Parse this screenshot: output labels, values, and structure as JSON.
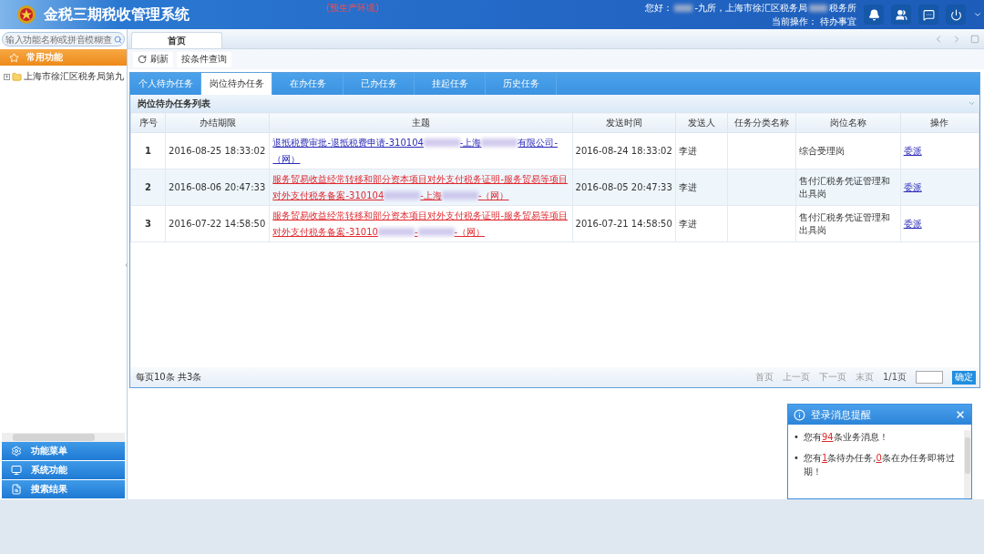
{
  "header": {
    "title": "金税三期税收管理系统",
    "environment": "(预生产环境)",
    "greeting": [
      {
        "text": "您好："
      },
      {
        "kind": "redacted"
      },
      {
        "text": "-九所，上海市徐汇区税务局"
      },
      {
        "kind": "redacted"
      },
      {
        "text": "税务所"
      }
    ],
    "operation_label": "当前操作：",
    "operation": "待办事宜"
  },
  "sidebar": {
    "search": {
      "placeholder": "输入功能名称或拼音模糊查"
    },
    "section": "常用功能",
    "tree": [
      {
        "label": "上海市徐汇区税务局第九",
        "expanded": false
      }
    ],
    "menus": [
      "功能菜单",
      "系统功能",
      "搜索结果"
    ]
  },
  "page_tabs": [
    {
      "label": "首页",
      "selected": true
    }
  ],
  "toolbar": [
    "刷新",
    "按条件查询"
  ],
  "task_tabs": [
    {
      "label": "个人待办任务",
      "selected": false
    },
    {
      "label": "岗位待办任务",
      "selected": true
    },
    {
      "label": "在办任务",
      "selected": false
    },
    {
      "label": "已办任务",
      "selected": false
    },
    {
      "label": "挂起任务",
      "selected": false
    },
    {
      "label": "历史任务",
      "selected": false
    }
  ],
  "panel_title": "岗位待办任务列表",
  "table": {
    "columns": [
      "序号",
      "办结期限",
      "主题",
      "发送时间",
      "发送人",
      "任务分类名称",
      "岗位名称",
      "操作"
    ],
    "rows": [
      {
        "index": "1",
        "deadline": "2016-08-25 18:33:02",
        "color": "#2a2ab8",
        "subject": [
          {
            "text": "退抵税费审批-退抵税费申请-310104"
          },
          {
            "kind": "redacted"
          },
          {
            "text": "-上海"
          },
          {
            "kind": "redacted"
          },
          {
            "text": "有限公司-（网）"
          }
        ],
        "sent": "2016-08-24 18:33:02",
        "sender": "李进",
        "post": "综合受理岗",
        "action": "委派"
      },
      {
        "index": "2",
        "deadline": "2016-08-06 20:47:33",
        "color": "#e0282e",
        "subject": [
          {
            "text": "服务贸易收益经常转移和部分资本项目对外支付税务证明-服务贸易等项目对外支付税务备案-310104"
          },
          {
            "kind": "redacted"
          },
          {
            "text": "-上海"
          },
          {
            "kind": "redacted"
          },
          {
            "text": "-（网）"
          }
        ],
        "sent": "2016-08-05 20:47:33",
        "sender": "李进",
        "post": "售付汇税务凭证管理和出具岗",
        "action": "委派"
      },
      {
        "index": "3",
        "deadline": "2016-07-22 14:58:50",
        "color": "#e0282e",
        "subject": [
          {
            "text": "服务贸易收益经常转移和部分资本项目对外支付税务证明-服务贸易等项目对外支付税务备案-31010"
          },
          {
            "kind": "redacted"
          },
          {
            "text": "-"
          },
          {
            "kind": "redacted"
          },
          {
            "text": "-（网）"
          }
        ],
        "sent": "2016-07-21 14:58:50",
        "sender": "李进",
        "post": "售付汇税务凭证管理和出具岗",
        "action": "委派"
      }
    ]
  },
  "pagination": {
    "summary": "每页10条 共3条",
    "links": [
      "首页",
      "上一页",
      "下一页",
      "末页"
    ],
    "page": "1/1页",
    "confirm": "确定"
  },
  "popup": {
    "title": "登录消息提醒",
    "marker": "•",
    "messages": [
      "您有**94**条业务消息！",
      "您有**1**条待办任务,**0**条在办任务即将过期！"
    ]
  }
}
